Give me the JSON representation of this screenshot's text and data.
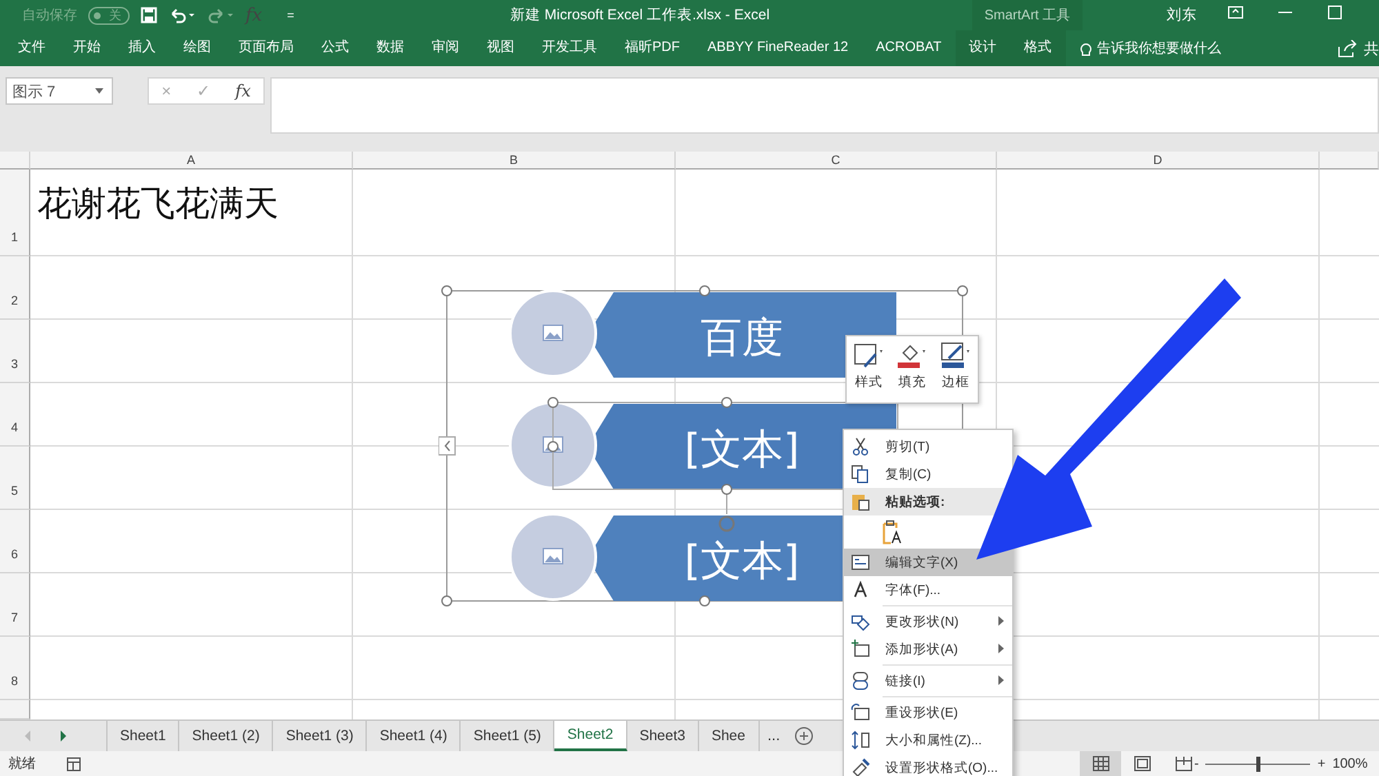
{
  "quick_access": {
    "autosave_label": "自动保存",
    "autosave_toggle": {
      "label": "关",
      "on": false
    },
    "formula_glyph": "fx",
    "customize_glyph": "="
  },
  "window": {
    "title": "新建 Microsoft Excel 工作表.xlsx  -  Excel",
    "context_tab_group": "SmartArt 工具",
    "user": "刘东"
  },
  "ribbon_tabs": [
    {
      "label": "文件",
      "kind": "normal",
      "selected": false
    },
    {
      "label": "开始",
      "kind": "normal",
      "selected": false
    },
    {
      "label": "插入",
      "kind": "normal",
      "selected": false
    },
    {
      "label": "绘图",
      "kind": "normal",
      "selected": false
    },
    {
      "label": "页面布局",
      "kind": "normal",
      "selected": false
    },
    {
      "label": "公式",
      "kind": "normal",
      "selected": false
    },
    {
      "label": "数据",
      "kind": "normal",
      "selected": false
    },
    {
      "label": "审阅",
      "kind": "normal",
      "selected": false
    },
    {
      "label": "视图",
      "kind": "normal",
      "selected": false
    },
    {
      "label": "开发工具",
      "kind": "normal",
      "selected": false
    },
    {
      "label": "福昕PDF",
      "kind": "normal",
      "selected": false
    },
    {
      "label": "ABBYY FineReader 12",
      "kind": "normal",
      "selected": false
    },
    {
      "label": "ACROBAT",
      "kind": "normal",
      "selected": false
    },
    {
      "label": "设计",
      "kind": "context",
      "selected": false
    },
    {
      "label": "格式",
      "kind": "context",
      "selected": false
    }
  ],
  "tell_me": {
    "placeholder": "告诉我你想要做什么"
  },
  "share": {
    "label": "共"
  },
  "formula_bar": {
    "name_box": "图示 7",
    "cancel_glyph": "×",
    "enter_glyph": "✓",
    "function_glyph": "fx"
  },
  "columns": [
    "A",
    "B",
    "C",
    "D"
  ],
  "rows": [
    "1",
    "2",
    "3",
    "4",
    "5",
    "6",
    "7",
    "8"
  ],
  "cell_a1": "花谢花飞花满天",
  "smartart": {
    "items": [
      {
        "text": "百度",
        "selected": false
      },
      {
        "text": "[文本]",
        "selected": true
      },
      {
        "text": "[文本]",
        "selected": false
      }
    ]
  },
  "mini_toolbar": [
    {
      "label": "样式",
      "kind": "style"
    },
    {
      "label": "填充",
      "kind": "fill"
    },
    {
      "label": "边框",
      "kind": "border"
    }
  ],
  "context_menu": [
    {
      "kind": "item",
      "label": "剪切(T)",
      "submenu": false,
      "selected": false
    },
    {
      "kind": "item",
      "label": "复制(C)",
      "submenu": false,
      "selected": false
    },
    {
      "kind": "header",
      "label": "粘贴选项:"
    },
    {
      "kind": "paste-options"
    },
    {
      "kind": "item",
      "label": "编辑文字(X)",
      "submenu": false,
      "selected": true
    },
    {
      "kind": "item",
      "label": "字体(F)...",
      "submenu": false,
      "selected": false
    },
    {
      "kind": "divider"
    },
    {
      "kind": "item",
      "label": "更改形状(N)",
      "submenu": true,
      "selected": false
    },
    {
      "kind": "item",
      "label": "添加形状(A)",
      "submenu": true,
      "selected": false
    },
    {
      "kind": "divider"
    },
    {
      "kind": "item",
      "label": "链接(I)",
      "submenu": true,
      "selected": false
    },
    {
      "kind": "divider"
    },
    {
      "kind": "item",
      "label": "重设形状(E)",
      "submenu": false,
      "selected": false
    },
    {
      "kind": "item",
      "label": "大小和属性(Z)...",
      "submenu": false,
      "selected": false
    },
    {
      "kind": "item",
      "label": "设置形状格式(O)...",
      "submenu": false,
      "selected": false
    }
  ],
  "sheet_tabs": [
    {
      "label": "Sheet1",
      "selected": false
    },
    {
      "label": "Sheet1 (2)",
      "selected": false
    },
    {
      "label": "Sheet1 (3)",
      "selected": false
    },
    {
      "label": "Sheet1 (4)",
      "selected": false
    },
    {
      "label": "Sheet1 (5)",
      "selected": false
    },
    {
      "label": "Sheet2",
      "selected": true
    },
    {
      "label": "Sheet3",
      "selected": false
    },
    {
      "label": "Shee",
      "selected": false
    }
  ],
  "sheet_overflow": "...",
  "status_bar": {
    "status": "就绪",
    "views": [
      {
        "kind": "normal",
        "selected": true
      },
      {
        "kind": "page-layout",
        "selected": false
      },
      {
        "kind": "page-break",
        "selected": false
      }
    ],
    "zoom_out": "-",
    "zoom_in": "+",
    "zoom": {
      "level": 0.5
    },
    "zoom_label": "100%"
  }
}
